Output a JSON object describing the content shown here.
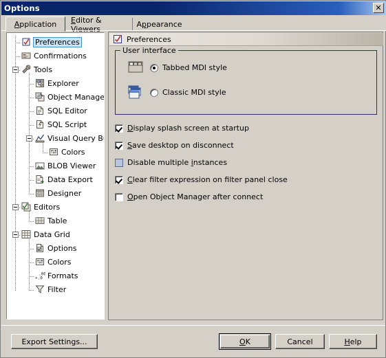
{
  "window": {
    "title": "Options",
    "close_icon": "close-icon",
    "close_glyph": "✕"
  },
  "tabs": [
    {
      "label": "Application",
      "mnemonic": "A",
      "active": true
    },
    {
      "label": "Editor & Viewers",
      "mnemonic": "E",
      "active": false
    },
    {
      "label": "Appearance",
      "mnemonic": "p",
      "active": false
    }
  ],
  "tree": {
    "items": [
      {
        "label": "Preferences",
        "icon": "preferences-icon",
        "depth": 0,
        "selected": true,
        "expander": null
      },
      {
        "label": "Confirmations",
        "icon": "confirmations-icon",
        "depth": 0,
        "selected": false,
        "expander": null
      },
      {
        "label": "Tools",
        "icon": "tools-icon",
        "depth": 0,
        "selected": false,
        "expander": "minus"
      },
      {
        "label": "Explorer",
        "icon": "explorer-icon",
        "depth": 1,
        "selected": false,
        "expander": null
      },
      {
        "label": "Object Manager",
        "icon": "object-manager-icon",
        "depth": 1,
        "selected": false,
        "expander": null
      },
      {
        "label": "SQL Editor",
        "icon": "sql-editor-icon",
        "depth": 1,
        "selected": false,
        "expander": null
      },
      {
        "label": "SQL Script",
        "icon": "sql-script-icon",
        "depth": 1,
        "selected": false,
        "expander": null
      },
      {
        "label": "Visual Query Builder",
        "icon": "visual-query-builder-icon",
        "depth": 1,
        "selected": false,
        "expander": "minus"
      },
      {
        "label": "Colors",
        "icon": "colors-icon",
        "depth": 2,
        "selected": false,
        "expander": null
      },
      {
        "label": "BLOB Viewer",
        "icon": "blob-viewer-icon",
        "depth": 1,
        "selected": false,
        "expander": null
      },
      {
        "label": "Data Export",
        "icon": "data-export-icon",
        "depth": 1,
        "selected": false,
        "expander": null
      },
      {
        "label": "Designer",
        "icon": "designer-icon",
        "depth": 1,
        "selected": false,
        "expander": null
      },
      {
        "label": "Editors",
        "icon": "editors-icon",
        "depth": 0,
        "selected": false,
        "expander": "minus"
      },
      {
        "label": "Table",
        "icon": "table-icon",
        "depth": 1,
        "selected": false,
        "expander": null
      },
      {
        "label": "Data Grid",
        "icon": "data-grid-icon",
        "depth": 0,
        "selected": false,
        "expander": "minus"
      },
      {
        "label": "Options",
        "icon": "options-icon",
        "depth": 1,
        "selected": false,
        "expander": null
      },
      {
        "label": "Colors",
        "icon": "colors-icon",
        "depth": 1,
        "selected": false,
        "expander": null
      },
      {
        "label": "Formats",
        "icon": "formats-icon",
        "depth": 1,
        "selected": false,
        "expander": null
      },
      {
        "label": "Filter",
        "icon": "filter-icon",
        "depth": 1,
        "selected": false,
        "expander": null
      }
    ]
  },
  "main": {
    "header": {
      "title": "Preferences",
      "icon": "preferences-icon"
    },
    "groupbox": {
      "title": "User interface",
      "radios": [
        {
          "label": "Tabbed MDI style",
          "checked": true,
          "icon": "tabbed-mdi-icon"
        },
        {
          "label": "Classic MDI style",
          "checked": false,
          "icon": "classic-mdi-icon"
        }
      ]
    },
    "checkboxes": [
      {
        "label": "Display splash screen at startup",
        "mnemonic": "D",
        "checked": true,
        "highlight": false
      },
      {
        "label": "Save desktop on disconnect",
        "mnemonic": "S",
        "checked": true,
        "highlight": false
      },
      {
        "label": "Disable multiple instances",
        "mnemonic": "i",
        "checked": false,
        "highlight": true
      },
      {
        "label": "Clear filter expression on filter panel close",
        "mnemonic": "C",
        "checked": true,
        "highlight": false
      },
      {
        "label": "Open Object Manager after connect",
        "mnemonic": "O",
        "checked": false,
        "highlight": false
      }
    ]
  },
  "buttons": {
    "export_settings": "Export Settings...",
    "ok": "OK",
    "cancel": "Cancel",
    "help": "Help"
  },
  "colors": {
    "titlebar_start": "#0a246a",
    "titlebar_end": "#a6caf0",
    "face": "#d4d0c8",
    "selection": "#cce4f7",
    "selection_border": "#4a90d9",
    "groupbox_border": "#2b2f6b",
    "checkbox_highlight": "#b8c4dc"
  }
}
